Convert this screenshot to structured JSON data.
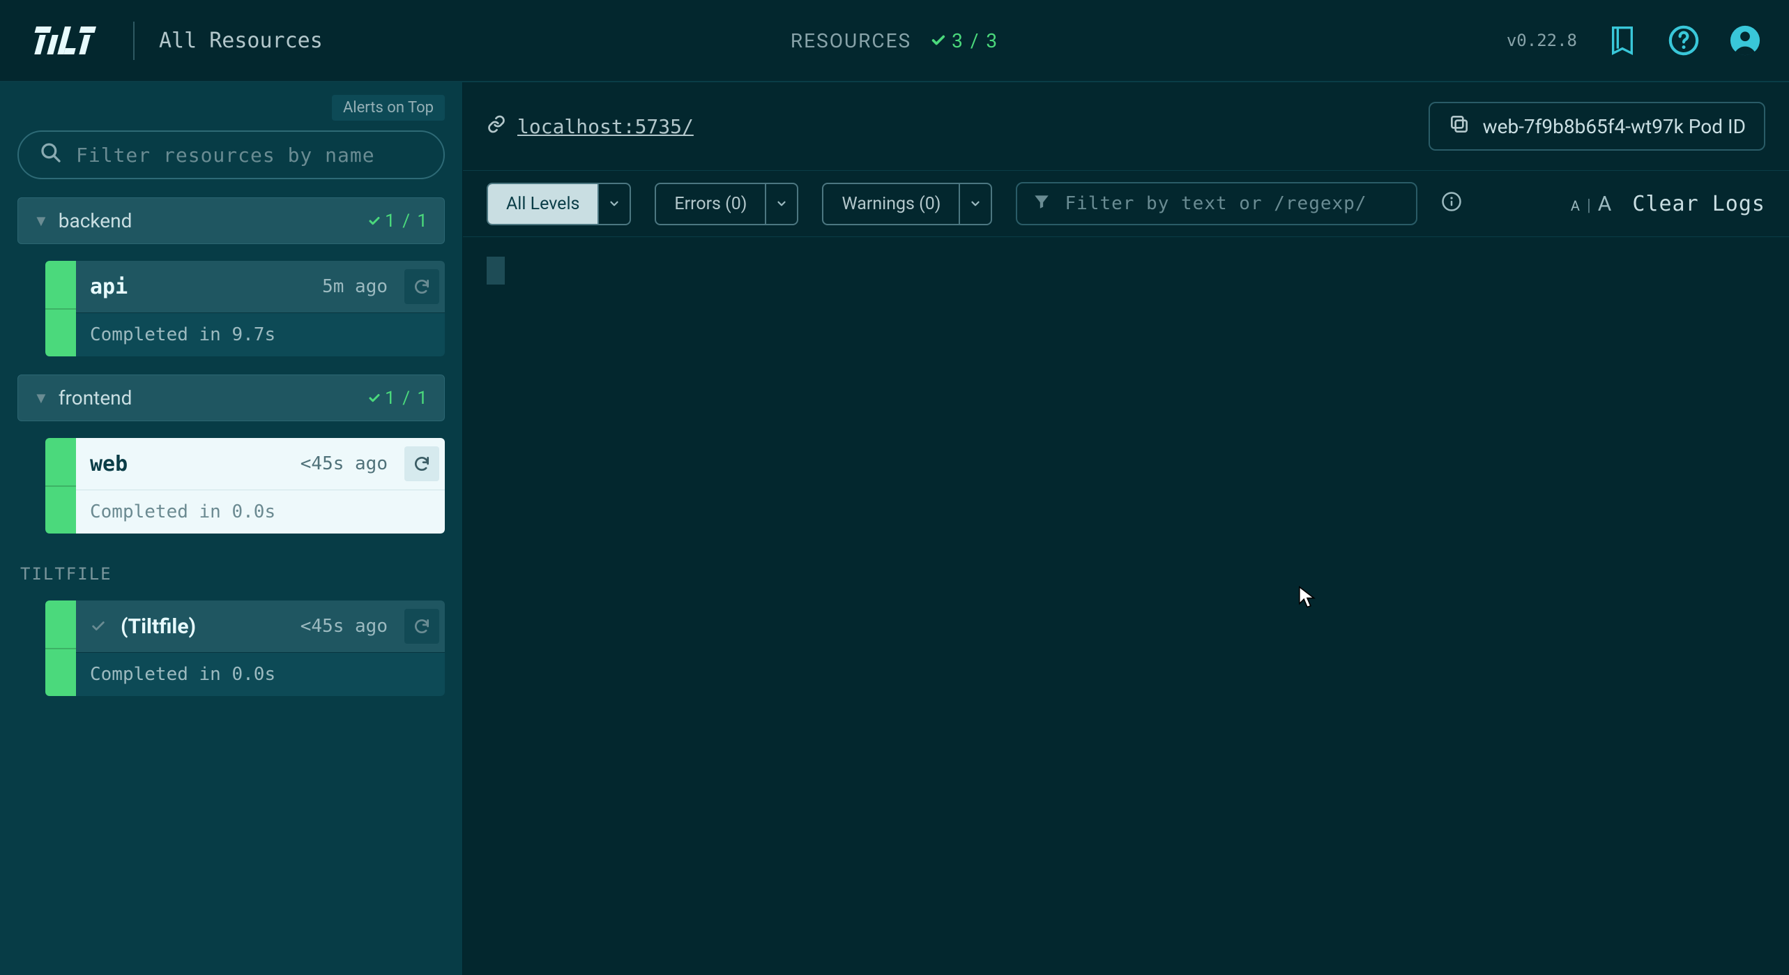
{
  "header": {
    "page_title": "All Resources",
    "resources_label": "RESOURCES",
    "resources_count": "3 / 3",
    "version": "v0.22.8"
  },
  "sidebar": {
    "alerts_on_top": "Alerts on Top",
    "filter_placeholder": "Filter resources by name",
    "groups": [
      {
        "name": "backend",
        "count": "1 / 1",
        "items": [
          {
            "name": "api",
            "time_ago": "5m ago",
            "status_text": "Completed in 9.7s"
          }
        ]
      },
      {
        "name": "frontend",
        "count": "1 / 1",
        "items": [
          {
            "name": "web",
            "time_ago": "<45s ago",
            "status_text": "Completed in 0.0s"
          }
        ]
      }
    ],
    "tiltfile_section_label": "TILTFILE",
    "tiltfile": {
      "name": "(Tiltfile)",
      "time_ago": "<45s ago",
      "status_text": "Completed in 0.0s"
    }
  },
  "content": {
    "endpoint": "localhost:5735/",
    "pod_id": "web-7f9b8b65f4-wt97k Pod ID",
    "toolbar": {
      "all_levels": "All Levels",
      "errors": "Errors (0)",
      "warnings": "Warnings (0)",
      "log_filter_placeholder": "Filter by text or /regexp/",
      "clear_logs": "Clear Logs"
    }
  }
}
